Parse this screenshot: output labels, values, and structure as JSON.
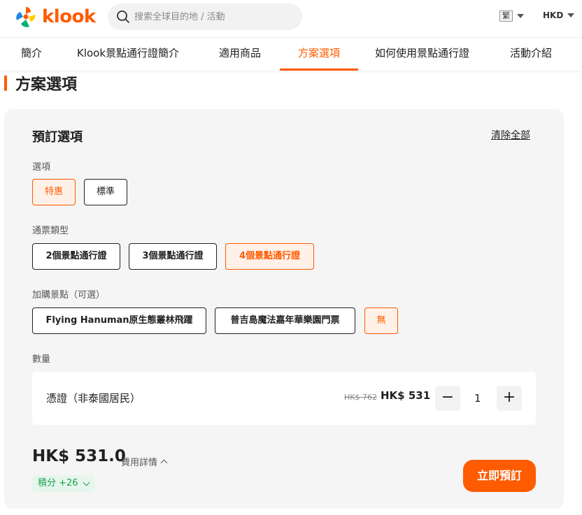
{
  "header": {
    "brand": "klook",
    "search_placeholder": "搜索全球目的地 / 活動",
    "language": "繁",
    "currency": "HKD"
  },
  "tabs": [
    {
      "label": "簡介"
    },
    {
      "label": "Klook景點通行證簡介"
    },
    {
      "label": "適用商品"
    },
    {
      "label": "方案選項",
      "active": true
    },
    {
      "label": "如何使用景點通行證"
    },
    {
      "label": "活動介紹"
    }
  ],
  "section_title": "方案選項",
  "booking": {
    "title": "預訂選項",
    "clear_all": "清除全部",
    "option_label": "選項",
    "options": [
      {
        "label": "特惠",
        "selected": true
      },
      {
        "label": "標準",
        "selected": false
      }
    ],
    "pass_type_label": "通票類型",
    "pass_types": [
      {
        "label": "2個景點通行證",
        "selected": false
      },
      {
        "label": "3個景點通行證",
        "selected": false
      },
      {
        "label": "4個景點通行證",
        "selected": true
      }
    ],
    "addon_label": "加購景點（可選）",
    "addons": [
      {
        "label": "Flying Hanuman原生態叢林飛躍",
        "selected": false
      },
      {
        "label": "普吉島魔法嘉年華樂園門票",
        "selected": false
      },
      {
        "label": "無",
        "selected": true
      }
    ],
    "quantity_label": "數量",
    "quantity": {
      "item_label": "憑證（非泰國居民）",
      "original_price": "HK$ 762",
      "price": "HK$ 531",
      "minus": "−",
      "value": "1",
      "plus": "+"
    },
    "total": "HK$ 531.0",
    "fee_detail": "費用詳情",
    "points": "積分 +26",
    "book_button": "立即預訂"
  },
  "colors": {
    "accent": "#ff5b00",
    "selected_bg": "#fff1e8",
    "points_green": "#16a34a",
    "card_bg": "#f5f5f5"
  }
}
